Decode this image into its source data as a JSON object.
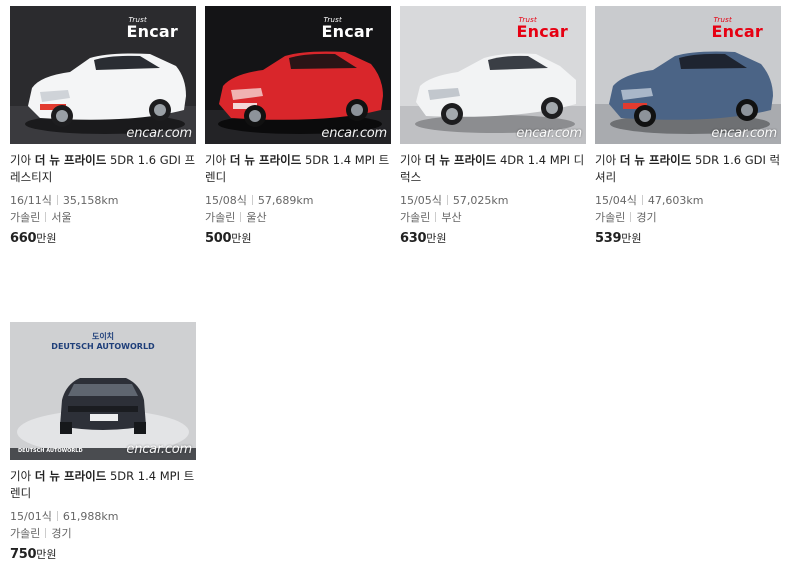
{
  "listings": [
    {
      "make": "기아",
      "model": "더 뉴 프라이드",
      "trim": "5DR 1.6 GDI 프레스티지",
      "year": "16/11식",
      "mileage": "35,158km",
      "fuel": "가솔린",
      "region": "서울",
      "price": "660",
      "price_unit": "만원",
      "photo_brand": "Encar",
      "photo_brand_tag": "Trust",
      "photo_watermark": "encar.com",
      "car_color": "#f4f5f6",
      "bg": "#2b2b2e"
    },
    {
      "make": "기아",
      "model": "더 뉴 프라이드",
      "trim": "5DR 1.4 MPI 트렌디",
      "year": "15/08식",
      "mileage": "57,689km",
      "fuel": "가솔린",
      "region": "울산",
      "price": "500",
      "price_unit": "만원",
      "photo_brand": "Encar",
      "photo_brand_tag": "Trust",
      "photo_watermark": "encar.com",
      "car_color": "#d9262b",
      "bg": "#141416"
    },
    {
      "make": "기아",
      "model": "더 뉴 프라이드",
      "trim": "4DR 1.4 MPI 디럭스",
      "year": "15/05식",
      "mileage": "57,025km",
      "fuel": "가솔린",
      "region": "부산",
      "price": "630",
      "price_unit": "만원",
      "photo_brand": "Encar",
      "photo_brand_tag": "Trust",
      "photo_watermark": "encar.com",
      "car_color": "#f2f3f4",
      "bg": "#d8d9db"
    },
    {
      "make": "기아",
      "model": "더 뉴 프라이드",
      "trim": "5DR 1.6 GDI 럭셔리",
      "year": "15/04식",
      "mileage": "47,603km",
      "fuel": "가솔린",
      "region": "경기",
      "price": "539",
      "price_unit": "만원",
      "photo_brand": "Encar",
      "photo_brand_tag": "Trust",
      "photo_watermark": "encar.com",
      "car_color": "#4b6486",
      "bg": "#c9cbce"
    },
    {
      "make": "기아",
      "model": "더 뉴 프라이드",
      "trim": "5DR 1.4 MPI 트렌디",
      "year": "15/01식",
      "mileage": "61,988km",
      "fuel": "가솔린",
      "region": "경기",
      "price": "750",
      "price_unit": "만원",
      "photo_brand": "DEUTSCH AUTOWORLD",
      "photo_brand_tag": "도이치",
      "photo_watermark": "encar.com",
      "car_color": "#2d3038",
      "bg": "#cfd0d2"
    }
  ]
}
